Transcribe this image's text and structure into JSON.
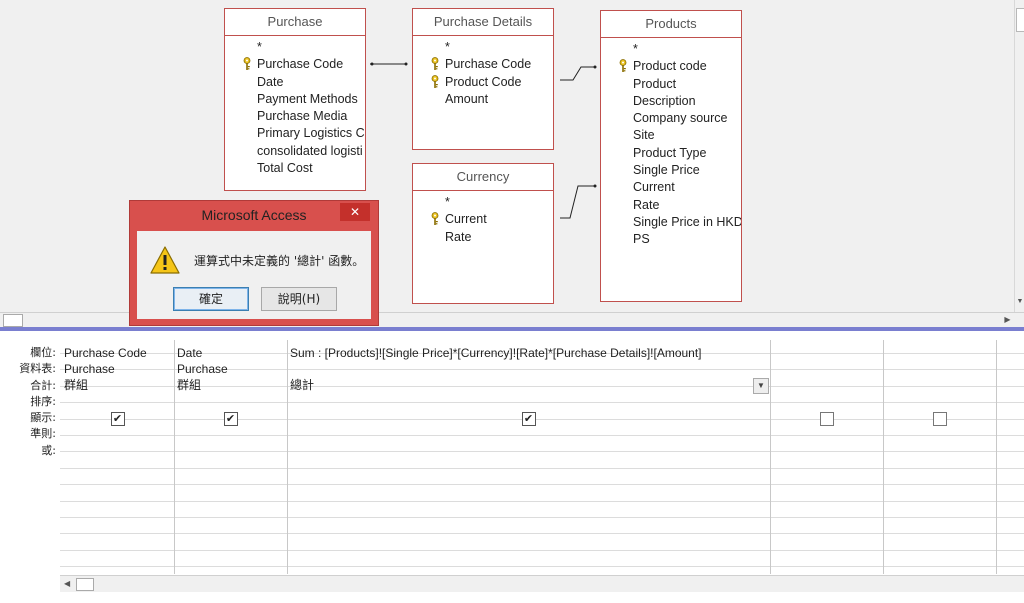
{
  "tables": {
    "purchase": {
      "title": "Purchase",
      "fields": [
        "*",
        "Purchase Code",
        "Date",
        "Payment Methods",
        "Purchase Media",
        "Primary Logistics Co",
        "consolidated logisti",
        "Total Cost"
      ]
    },
    "purchase_details": {
      "title": "Purchase Details",
      "fields": [
        "*",
        "Purchase Code",
        "Product Code",
        "Amount"
      ]
    },
    "currency": {
      "title": "Currency",
      "fields": [
        "*",
        "Current",
        "Rate"
      ]
    },
    "products": {
      "title": "Products",
      "fields": [
        "*",
        "Product code",
        "Product",
        "Description",
        "Company source",
        "Site",
        "Product Type",
        "Single Price",
        "Current",
        "Rate",
        "Single Price in HKD",
        "PS"
      ]
    }
  },
  "dialog": {
    "title": "Microsoft Access",
    "close": "✕",
    "message": "運算式中未定義的 '總計' 函數。",
    "ok_label": "確定",
    "help_label": "說明(H)"
  },
  "grid": {
    "row_labels": [
      "欄位:",
      "資料表:",
      "合計:",
      "排序:",
      "顯示:",
      "準則:",
      "或:"
    ],
    "columns": [
      {
        "field": "Purchase Code",
        "table": "Purchase",
        "total": "群組",
        "show": true
      },
      {
        "field": "Date",
        "table": "Purchase",
        "total": "群組",
        "show": true
      },
      {
        "field": "Sum : [Products]![Single Price]*[Currency]![Rate]*[Purchase Details]![Amount]",
        "table": "",
        "total": "總計",
        "show": true
      },
      {
        "field": "",
        "table": "",
        "total": "",
        "show": false
      },
      {
        "field": "",
        "table": "",
        "total": "",
        "show": false
      }
    ]
  },
  "colors": {
    "table_border": "#c0504d",
    "dialog_frame": "#d8504d",
    "divider": "#7a7fd0"
  }
}
